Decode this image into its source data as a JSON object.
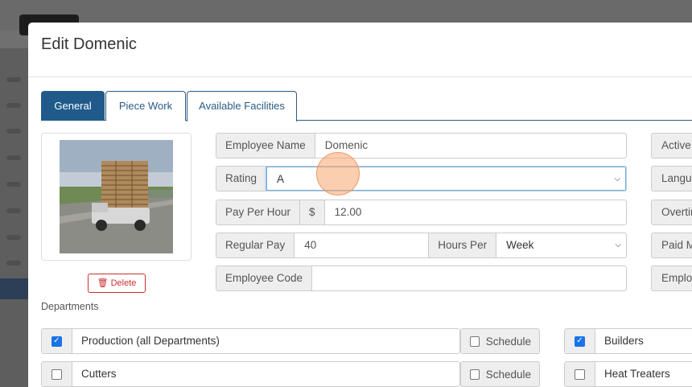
{
  "modal": {
    "title": "Edit Domenic"
  },
  "tabs": [
    {
      "label": "General",
      "active": true
    },
    {
      "label": "Piece Work",
      "active": false
    },
    {
      "label": "Available Facilities",
      "active": false
    }
  ],
  "photo": {
    "delete_label": "Delete"
  },
  "form": {
    "employee_name_label": "Employee Name",
    "employee_name_value": "Domenic",
    "rating_label": "Rating",
    "rating_value": "A",
    "pay_per_hour_label": "Pay Per Hour",
    "currency_symbol": "$",
    "pay_per_hour_value": "12.00",
    "regular_pay_label": "Regular Pay",
    "regular_pay_value": "40",
    "hours_per_label": "Hours Per",
    "hours_per_value": "Week",
    "employee_code_label": "Employee Code",
    "employee_code_value": ""
  },
  "right_column": [
    "Active",
    "Langua",
    "Overtir",
    "Paid M",
    "Employ"
  ],
  "departments": {
    "label": "Departments",
    "schedule_label": "Schedule",
    "left": [
      {
        "name": "Production (all Departments)",
        "checked": true,
        "schedule": false
      },
      {
        "name": "Cutters",
        "checked": false,
        "schedule": false
      }
    ],
    "right": [
      {
        "name": "Builders",
        "checked": true
      },
      {
        "name": "Heat Treaters",
        "checked": false
      }
    ]
  },
  "colors": {
    "primary": "#1f5a8a",
    "danger": "#c9302c",
    "checkbox_checked": "#1a73e8",
    "cursor_highlight": "#f7a66e"
  }
}
